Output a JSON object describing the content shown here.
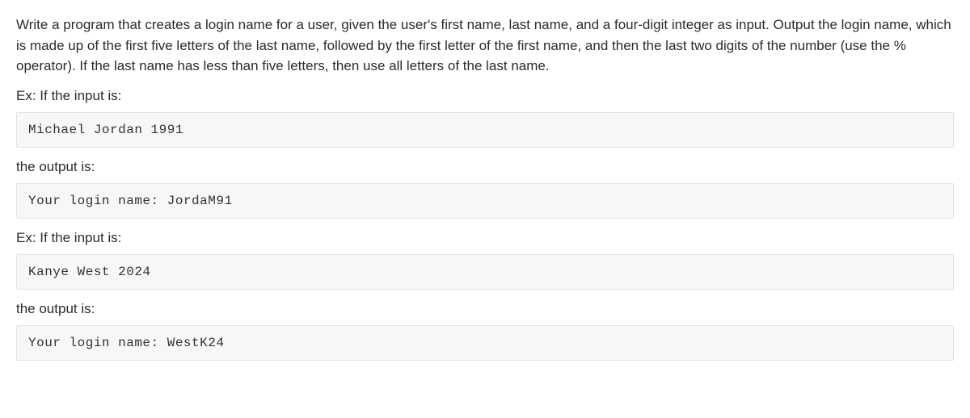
{
  "intro_text": "Write a program that creates a login name for a user, given the user's first name, last name, and a four-digit integer as input. Output the login name, which is made up of the first five letters of the last name, followed by the first letter of the first name, and then the last two digits of the number (use the % operator). If the last name has less than five letters, then use all letters of the last name.",
  "example1": {
    "input_label": "Ex: If the input is:",
    "input_value": "Michael Jordan 1991",
    "output_label": "the output is:",
    "output_value": "Your login name: JordaM91"
  },
  "example2": {
    "input_label": "Ex: If the input is:",
    "input_value": "Kanye West 2024",
    "output_label": "the output is:",
    "output_value": "Your login name: WestK24"
  }
}
